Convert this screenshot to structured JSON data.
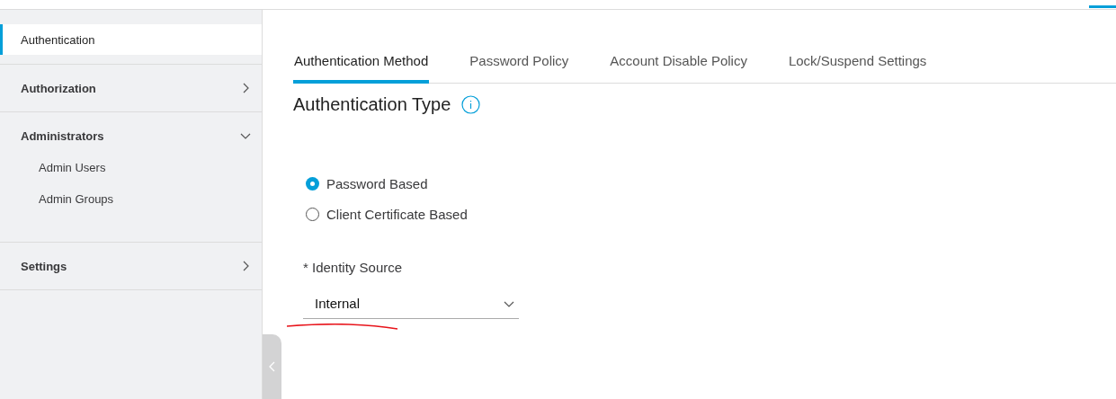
{
  "sidebar": {
    "items": [
      {
        "label": "Authentication",
        "kind": "link",
        "selected": true
      },
      {
        "label": "Authorization",
        "kind": "group",
        "selected": false,
        "expanded": false
      },
      {
        "label": "Administrators",
        "kind": "group",
        "selected": false,
        "expanded": true,
        "children": [
          {
            "label": "Admin Users",
            "selected": false
          },
          {
            "label": "Admin Groups",
            "selected": false
          }
        ]
      },
      {
        "label": "Settings",
        "kind": "group",
        "selected": false,
        "expanded": false
      }
    ]
  },
  "tabs": [
    {
      "label": "Authentication Method",
      "selected": true
    },
    {
      "label": "Password Policy",
      "selected": false
    },
    {
      "label": "Account Disable Policy",
      "selected": false
    },
    {
      "label": "Lock/Suspend Settings",
      "selected": false
    }
  ],
  "section": {
    "title": "Authentication Type",
    "options": [
      {
        "label": "Password Based",
        "selected": true
      },
      {
        "label": "Client Certificate Based",
        "selected": false
      }
    ],
    "identity_source": {
      "label": "* Identity Source",
      "value": "Internal"
    }
  }
}
